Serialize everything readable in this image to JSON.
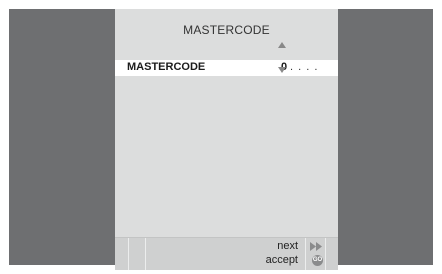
{
  "screen": {
    "title": "MASTERCODE"
  },
  "code_row": {
    "label": "MASTERCODE",
    "entered_digit": "0",
    "remaining_placeholder": ". . . ."
  },
  "bottom_bar": {
    "next_label": "next",
    "accept_label": "accept",
    "go_icon_text": "GO"
  },
  "colors": {
    "background_side": "#6e6f71",
    "panel": "#dcdddd",
    "highlight_row": "#ffffff",
    "arrow": "#888888"
  },
  "icons": {
    "up": "arrow-up-icon",
    "down": "arrow-down-icon",
    "next": "fast-forward-icon",
    "accept": "go-icon"
  }
}
